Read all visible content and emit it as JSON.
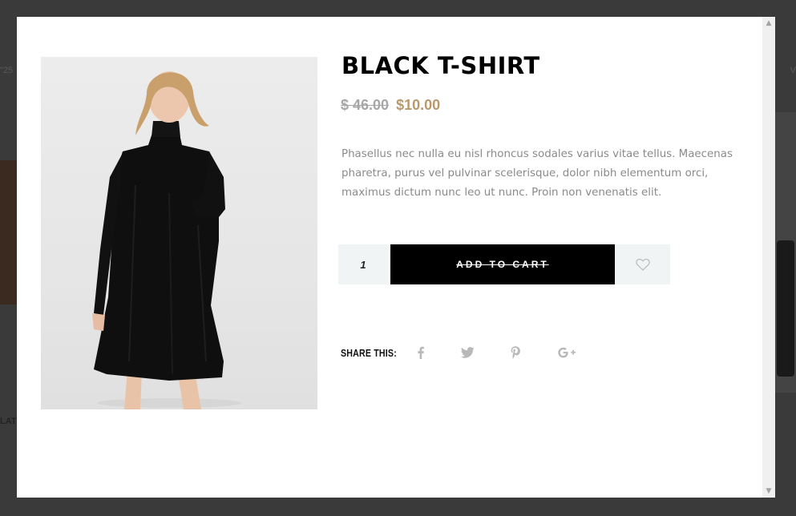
{
  "background": {
    "left_text": "\"25",
    "left_text2": "LAT",
    "right_text": "V"
  },
  "product": {
    "title": "BLACK T-SHIRT",
    "price_old": "$ 46.00",
    "price_new": "$10.00",
    "description": "Phasellus nec nulla eu nisl rhoncus sodales varius vitae tellus. Maecenas pharetra, purus vel pulvinar scelerisque, dolor nibh elementum orci, maximus dictum nunc leo ut nunc. Proin non venenatis elit.",
    "image_icon": "product-photo-black-dress"
  },
  "cart": {
    "quantity": "1",
    "add_to_cart_label": "ADD TO CART",
    "wishlist_icon": "heart-icon"
  },
  "share": {
    "label": "SHARE THIS:",
    "icons": [
      "facebook-icon",
      "twitter-icon",
      "pinterest-icon",
      "google-plus-icon"
    ]
  },
  "colors": {
    "accent_price": "#b8996b",
    "old_price": "#a7a7a7",
    "button_bg": "#000000",
    "input_bg": "#f1f4f4",
    "overlay_bg": "#3d3d3d"
  }
}
